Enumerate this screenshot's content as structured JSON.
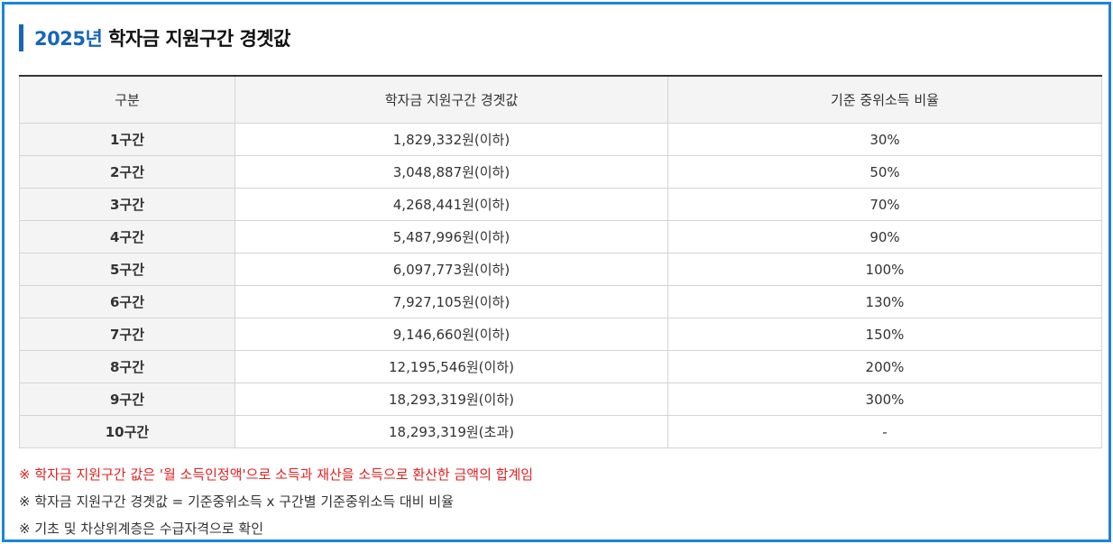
{
  "title": {
    "year": "2025년",
    "rest": "학자금 지원구간 경곗값"
  },
  "table": {
    "headers": [
      "구분",
      "학자금 지원구간 경곗값",
      "기준 중위소득 비율"
    ],
    "rows": [
      {
        "category": "1구간",
        "amount": "1,829,332원(이하)",
        "ratio": "30%"
      },
      {
        "category": "2구간",
        "amount": "3,048,887원(이하)",
        "ratio": "50%"
      },
      {
        "category": "3구간",
        "amount": "4,268,441원(이하)",
        "ratio": "70%"
      },
      {
        "category": "4구간",
        "amount": "5,487,996원(이하)",
        "ratio": "90%"
      },
      {
        "category": "5구간",
        "amount": "6,097,773원(이하)",
        "ratio": "100%"
      },
      {
        "category": "6구간",
        "amount": "7,927,105원(이하)",
        "ratio": "130%"
      },
      {
        "category": "7구간",
        "amount": "9,146,660원(이하)",
        "ratio": "150%"
      },
      {
        "category": "8구간",
        "amount": "12,195,546원(이하)",
        "ratio": "200%"
      },
      {
        "category": "9구간",
        "amount": "18,293,319원(이하)",
        "ratio": "300%"
      },
      {
        "category": "10구간",
        "amount": "18,293,319원(초과)",
        "ratio": "-"
      }
    ]
  },
  "notes": [
    "※ 학자금 지원구간 값은 '월 소득인정액'으로 소득과 재산을 소득으로 환산한 금액의 합계임",
    "※ 학자금 지원구간 경곗값 = 기준중위소득 x 구간별 기준중위소득 대비 비율",
    "※ 기초 및 차상위계층은 수급자격으로 확인"
  ],
  "colors": {
    "frame_border": "#1a86d6",
    "accent_blue": "#1766b8",
    "note_red": "#e02020",
    "header_bg": "#f4f4f4"
  }
}
